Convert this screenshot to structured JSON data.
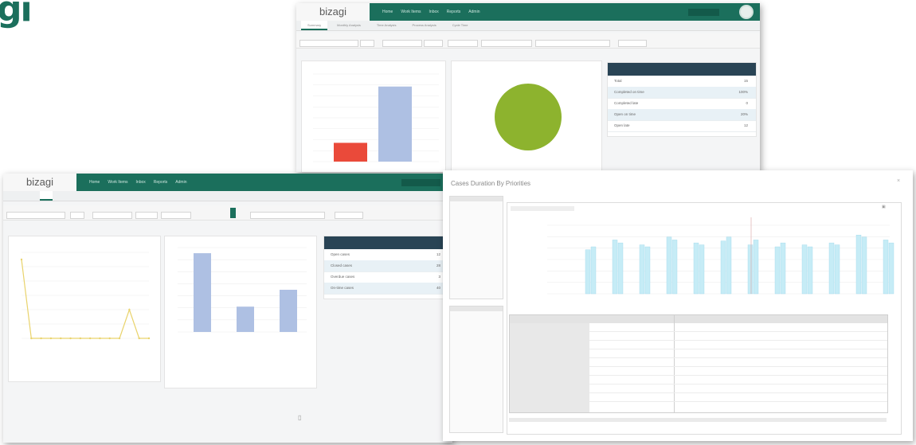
{
  "corner_logo": "gi",
  "brand": "bizagi",
  "win1": {
    "nav": [
      "Home",
      "Work Items",
      "Inbox",
      "Reports",
      "Admin"
    ],
    "tabs": [
      "Summary",
      "Monthly Analysis",
      "Time Analysis",
      "Process Analysis",
      "Cycle Time"
    ],
    "user_icon": "user-avatar-icon",
    "bar_chart": {
      "values": [
        3,
        12
      ],
      "colors": [
        "#ea4a3a",
        "#aec0e3"
      ]
    },
    "pie_chart": {
      "values": [
        1
      ],
      "colors": [
        "#8db32e"
      ]
    },
    "kpi_rows": [
      {
        "label": "Total",
        "value": "15"
      },
      {
        "label": "Completed on time",
        "value": "100%"
      },
      {
        "label": "Completed late",
        "value": "0"
      },
      {
        "label": "Open on time",
        "value": "20%"
      },
      {
        "label": "Open late",
        "value": "12"
      }
    ]
  },
  "win2": {
    "nav": [
      "Home",
      "Work Items",
      "Inbox",
      "Reports",
      "Admin"
    ],
    "line_chart": {
      "values": [
        22,
        0,
        0,
        0,
        0,
        0,
        0,
        0,
        0,
        0,
        0,
        8,
        0,
        0
      ],
      "color": "#e9d36c"
    },
    "bar_chart": {
      "values": [
        28,
        9,
        15
      ],
      "color": "#aec0e3"
    },
    "kpi_rows": [
      {
        "label": "Open cases",
        "value": "12"
      },
      {
        "label": "Closed cases",
        "value": "28"
      },
      {
        "label": "Overdue cases",
        "value": "3"
      },
      {
        "label": "On-time cases",
        "value": "40"
      }
    ]
  },
  "win3": {
    "title": "Cases Duration By Priorities",
    "bar_pairs": [
      [
        45,
        48
      ],
      [
        55,
        52
      ],
      [
        50,
        48
      ],
      [
        58,
        55
      ],
      [
        52,
        50
      ],
      [
        54,
        58
      ],
      [
        50,
        55
      ],
      [
        48,
        52
      ],
      [
        50,
        48
      ],
      [
        52,
        50
      ],
      [
        60,
        58
      ],
      [
        55,
        52
      ]
    ],
    "bar_color": "#c6ecf6",
    "table_rows": 9
  }
}
